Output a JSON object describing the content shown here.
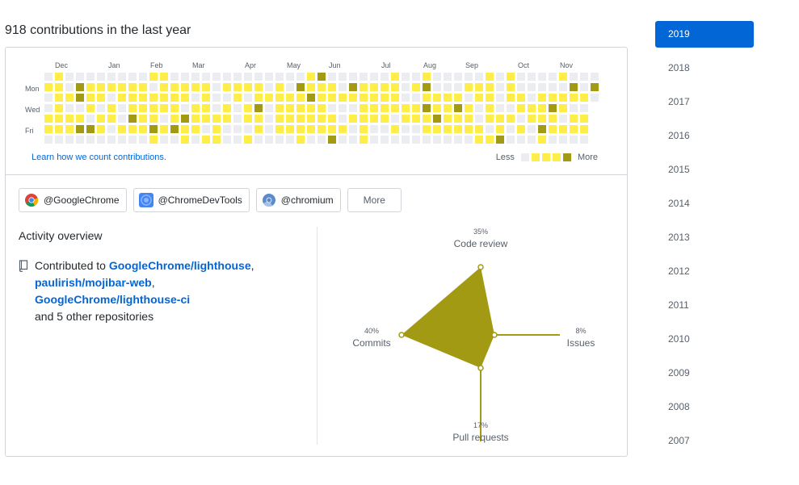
{
  "header": {
    "title": "918 contributions in the last year"
  },
  "calendar": {
    "months": [
      "Dec",
      "Jan",
      "Feb",
      "Mar",
      "Apr",
      "May",
      "Jun",
      "Jul",
      "Aug",
      "Sep",
      "Oct",
      "Nov"
    ],
    "day_labels": [
      "Mon",
      "Wed",
      "Fri"
    ],
    "learn_link": "Learn how we count contributions.",
    "legend_less": "Less",
    "legend_more": "More",
    "colors": [
      "#ebedf0",
      "#ffee4a",
      "#ffee4a",
      "#ffee4a",
      "#a29a13"
    ]
  },
  "orgs": [
    {
      "label": "@GoogleChrome",
      "icon": "chrome-logo"
    },
    {
      "label": "@ChromeDevTools",
      "icon": "devtools-logo"
    },
    {
      "label": "@chromium",
      "icon": "chromium-logo"
    }
  ],
  "orgs_more": "More",
  "activity": {
    "heading": "Activity overview",
    "prefix": "Contributed to",
    "repos": [
      "GoogleChrome/lighthouse",
      "paulirish/mojibar-web",
      "GoogleChrome/lighthouse-ci"
    ],
    "suffix": "and 5 other repositories"
  },
  "radar": {
    "code_review": {
      "label": "Code review",
      "pct": "35%"
    },
    "issues": {
      "label": "Issues",
      "pct": "8%"
    },
    "pull_requests": {
      "label": "Pull requests",
      "pct": "17%"
    },
    "commits": {
      "label": "Commits",
      "pct": "40%"
    },
    "fill_color": "#a29a13"
  },
  "years": [
    "2019",
    "2018",
    "2017",
    "2016",
    "2015",
    "2014",
    "2013",
    "2012",
    "2011",
    "2010",
    "2009",
    "2008",
    "2007"
  ],
  "active_year": "2019"
}
